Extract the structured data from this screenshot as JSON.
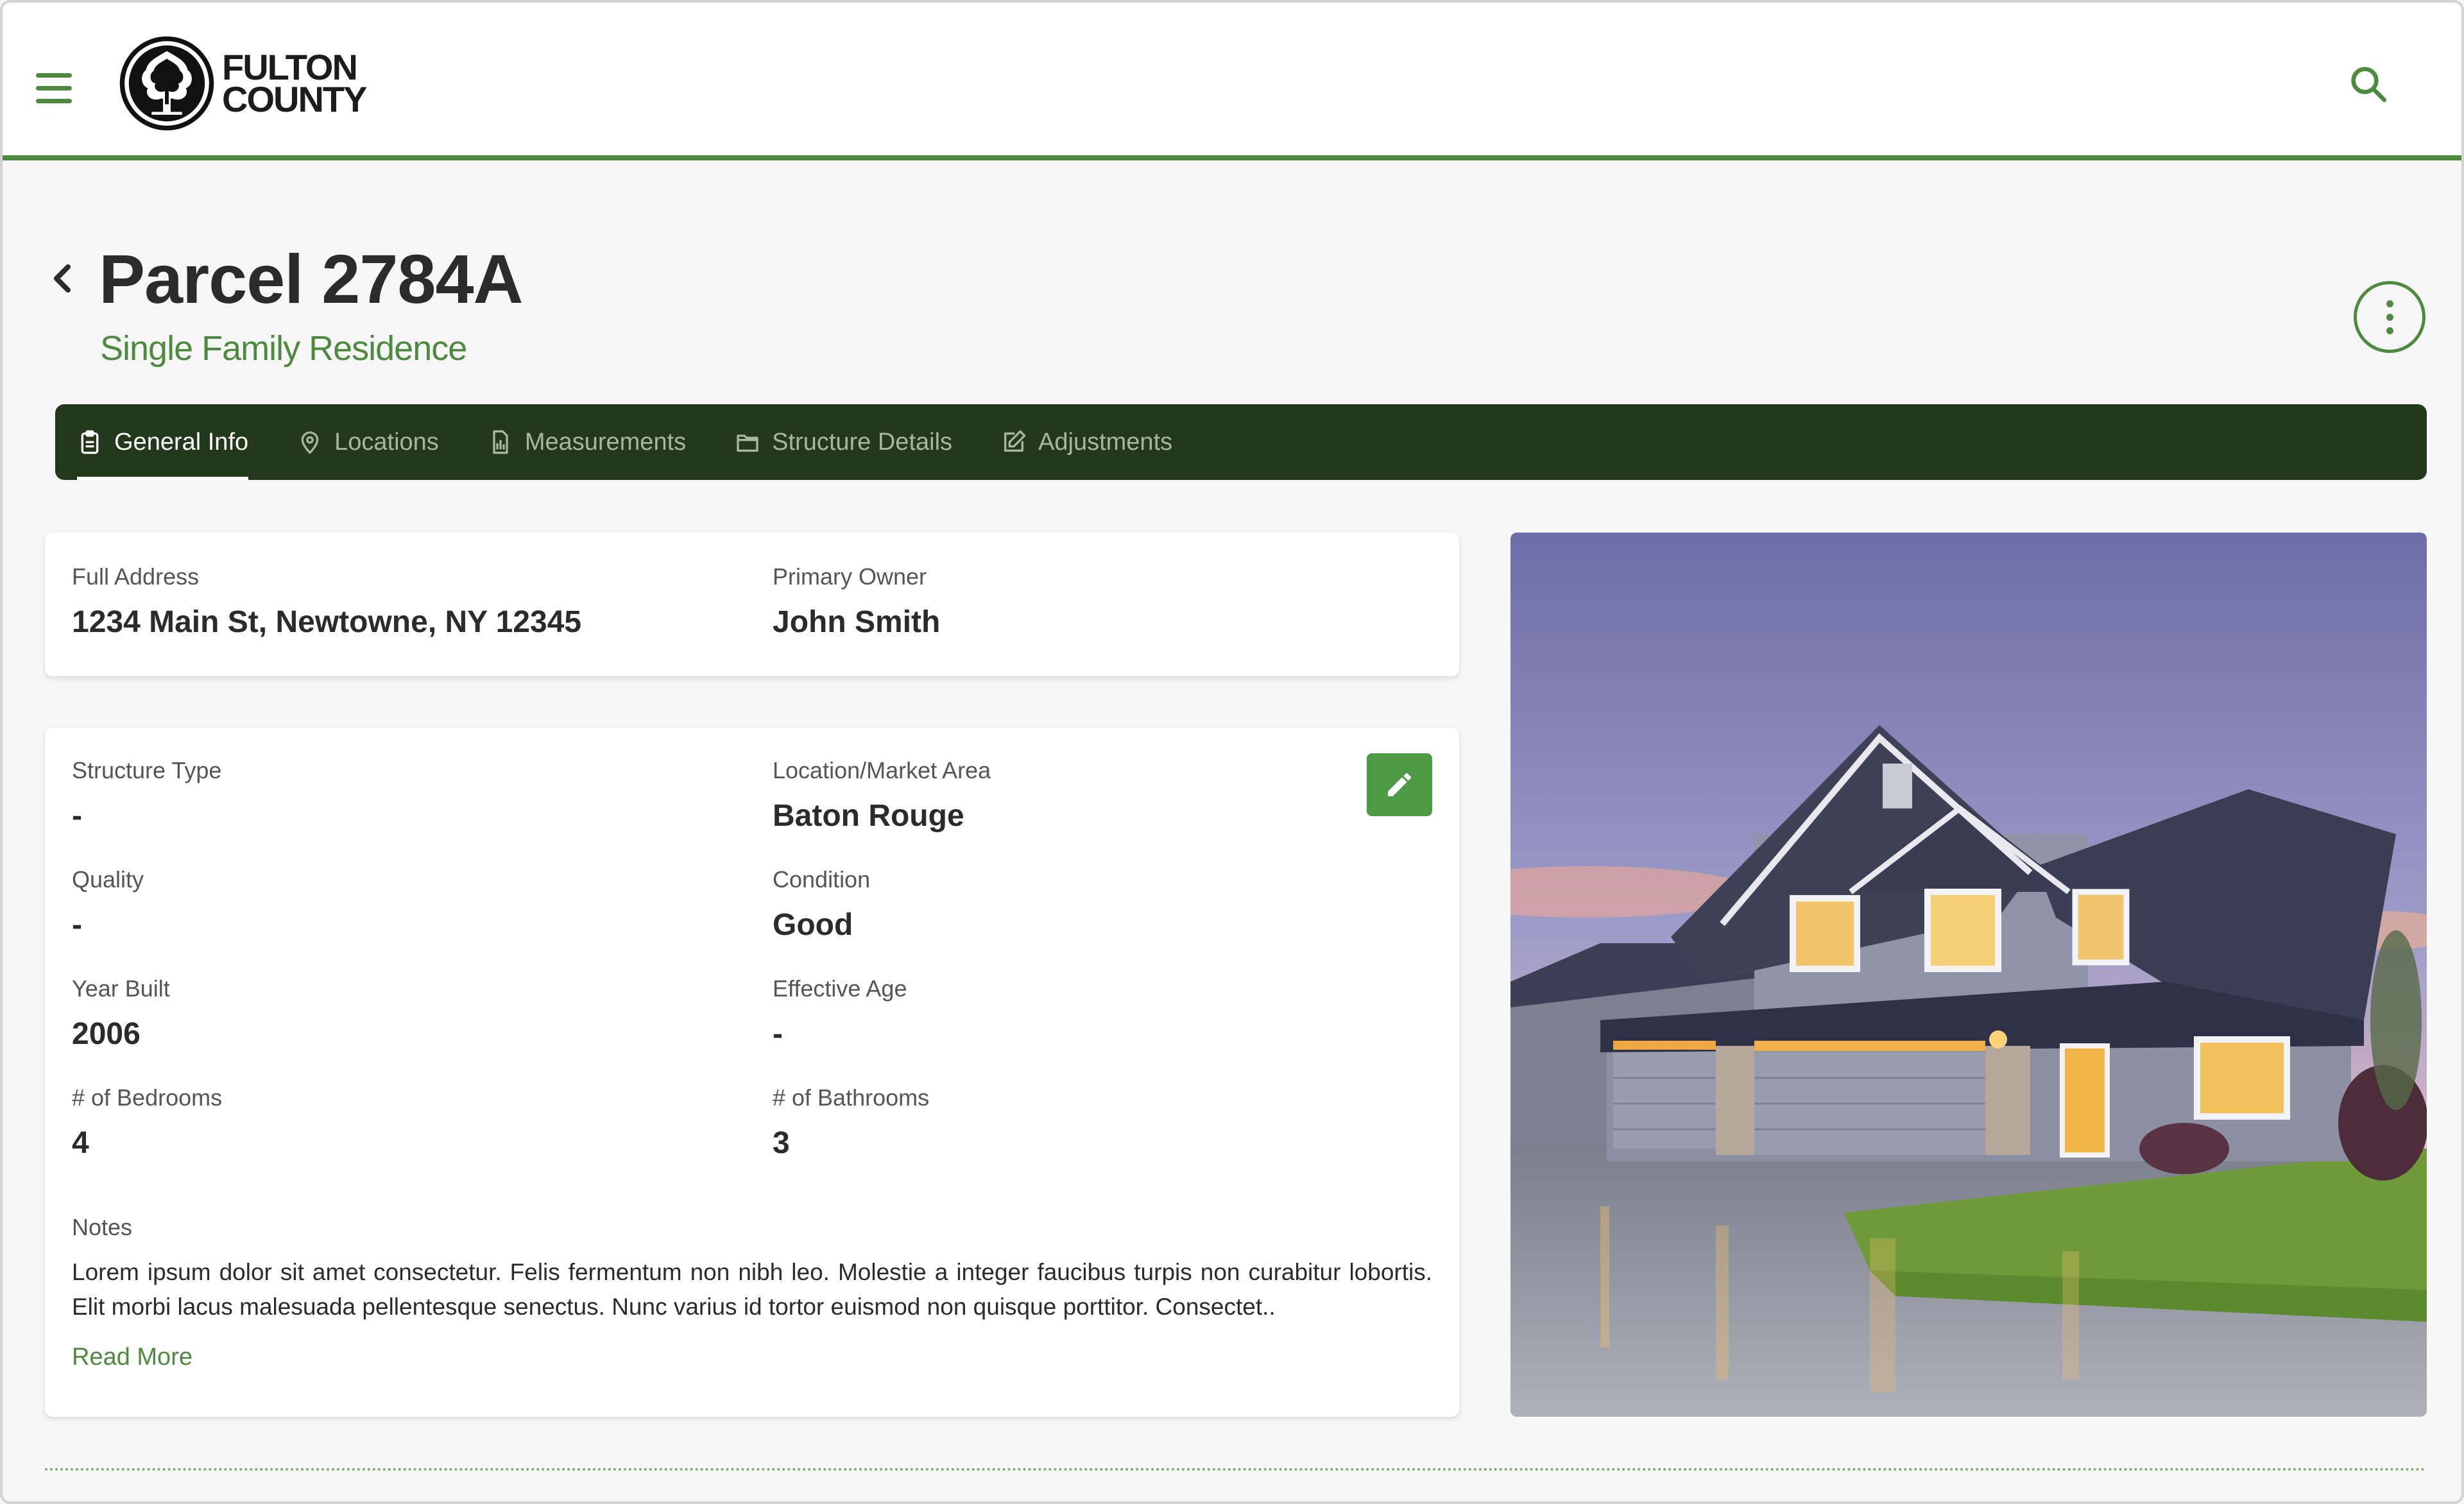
{
  "brand": {
    "logo_line1": "FULTON",
    "logo_line2": "COUNTY",
    "accent": "#4d8a3f",
    "tab_bg": "#24391c"
  },
  "page": {
    "title": "Parcel 2784A",
    "subtitle": "Single Family Residence"
  },
  "tabs": [
    {
      "label": "General Info",
      "icon": "clipboard-icon",
      "active": true
    },
    {
      "label": "Locations",
      "icon": "map-pin-icon"
    },
    {
      "label": "Measurements",
      "icon": "chart-document-icon"
    },
    {
      "label": "Structure Details",
      "icon": "folder-icon"
    },
    {
      "label": "Adjustments",
      "icon": "edit-icon"
    }
  ],
  "summary": {
    "address_label": "Full Address",
    "address": "1234 Main St, Newtowne, NY 12345",
    "owner_label": "Primary Owner",
    "owner": "John Smith"
  },
  "details": {
    "structure_type_label": "Structure Type",
    "structure_type": "-",
    "location_label": "Location/Market Area",
    "location": "Baton Rouge",
    "quality_label": "Quality",
    "quality": "-",
    "condition_label": "Condition",
    "condition": "Good",
    "year_built_label": "Year Built",
    "year_built": "2006",
    "effective_age_label": "Effective Age",
    "effective_age": "-",
    "bedrooms_label": "# of Bedrooms",
    "bedrooms": "4",
    "bathrooms_label": "# of Bathrooms",
    "bathrooms": "3",
    "notes_label": "Notes",
    "notes": "Lorem ipsum dolor sit amet consectetur. Felis fermentum non nibh leo. Molestie a integer faucibus turpis non curabitur lobortis. Elit morbi lacus malesuada pellentesque senectus. Nunc varius id tortor euismod non quisque porttitor. Consectet..",
    "read_more": "Read More"
  }
}
